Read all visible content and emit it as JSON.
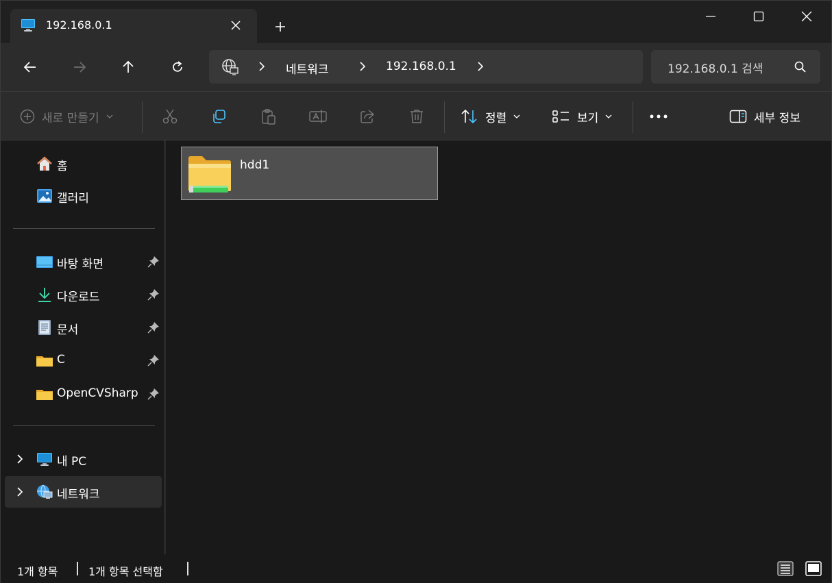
{
  "tab": {
    "title": "192.168.0.1",
    "icon": "monitor-icon"
  },
  "address": {
    "crumbs": [
      "네트워크",
      "192.168.0.1"
    ]
  },
  "search": {
    "placeholder": "192.168.0.1 검색"
  },
  "commands": {
    "new_label": "새로 만들기",
    "sort_label": "정렬",
    "view_label": "보기",
    "details_label": "세부 정보"
  },
  "sidebar": {
    "quick": [
      {
        "label": "홈",
        "icon": "home-icon"
      },
      {
        "label": "갤러리",
        "icon": "gallery-icon"
      }
    ],
    "pinned": [
      {
        "label": "바탕 화면",
        "icon": "desktop-icon"
      },
      {
        "label": "다운로드",
        "icon": "download-icon"
      },
      {
        "label": "문서",
        "icon": "document-icon"
      },
      {
        "label": "C",
        "icon": "folder-icon"
      },
      {
        "label": "OpenCVSharp",
        "icon": "folder-icon"
      }
    ],
    "roots": [
      {
        "label": "내 PC",
        "icon": "pc-icon"
      },
      {
        "label": "네트워크",
        "icon": "network-icon",
        "selected": true
      }
    ]
  },
  "content": {
    "items": [
      {
        "name": "hdd1",
        "icon": "shared-folder-icon",
        "selected": true
      }
    ]
  },
  "status": {
    "count": "1개 항목",
    "selected": "1개 항목 선택함"
  },
  "colors": {
    "accent": "#4cc2ff",
    "folder": "#f5c542",
    "share_bar": "#3fcf5a"
  }
}
